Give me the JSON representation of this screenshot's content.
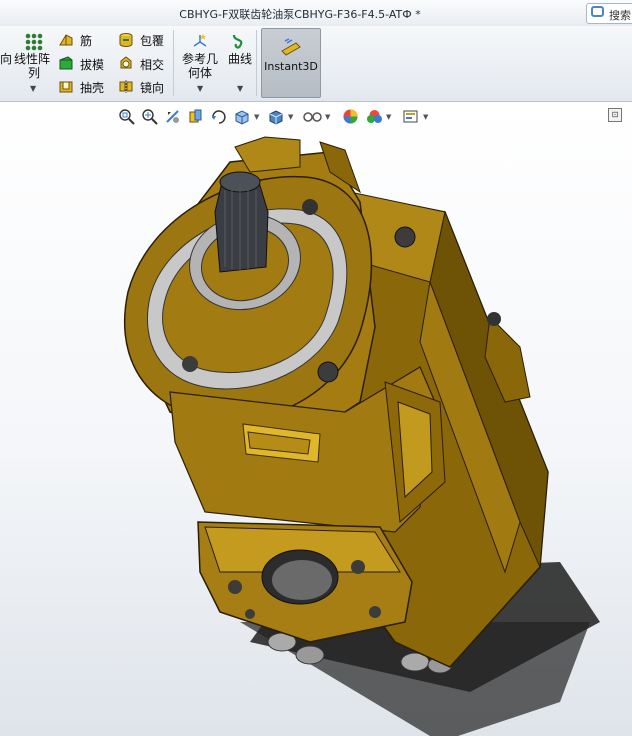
{
  "window": {
    "title": "CBHYG-F双联齿轮油泵CBHYG-F36-F4.5-ATФ *",
    "search_label": "搜索"
  },
  "ribbon": {
    "left_partial_label": "向",
    "linear_pattern_label_1": "线性阵",
    "linear_pattern_label_2": "列",
    "rib_label": "筋",
    "draft_label": "拔模",
    "shell_label": "抽壳",
    "wrap_label": "包覆",
    "intersect_label": "相交",
    "mirror_label": "镜向",
    "ref_geometry_label_1": "参考几",
    "ref_geometry_label_2": "何体",
    "curves_label": "曲线",
    "instant3d_label": "Instant3D"
  },
  "heads_up_toolbar": {
    "icons": [
      "zoom-to-fit-icon",
      "zoom-to-area-icon",
      "previous-view-icon",
      "section-view-icon",
      "dynamic-annotation-icon",
      "view-orientation-icon",
      "display-style-icon",
      "hide-show-items-icon",
      "edit-appearance-icon",
      "apply-scene-icon",
      "view-settings-icon"
    ]
  },
  "colors": {
    "part_body": "#9a7310",
    "part_light": "#c39b1e",
    "part_dark": "#5c4505",
    "accent_blue": "#3b7bd1"
  }
}
